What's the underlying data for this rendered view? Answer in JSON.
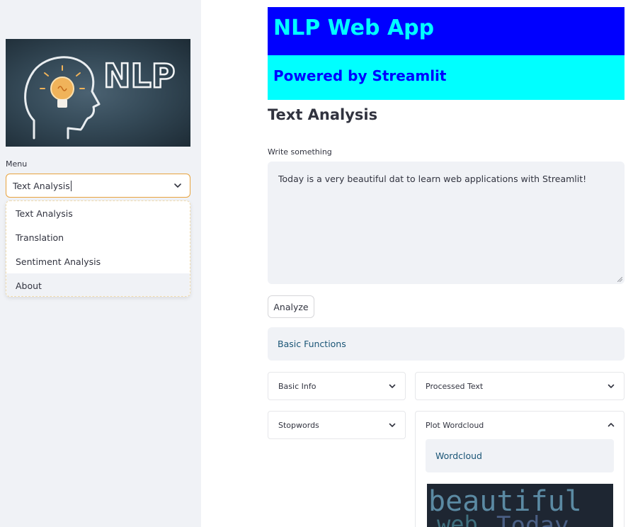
{
  "sidebar": {
    "image": {
      "label": "NLP"
    },
    "menu_label": "Menu",
    "select_value": "Text Analysis",
    "options": [
      "Text Analysis",
      "Translation",
      "Sentiment Analysis",
      "About"
    ],
    "hovered_option": "About"
  },
  "main": {
    "banner_title": "NLP Web App",
    "banner_subtitle": "Powered by Streamlit",
    "section_title": "Text Analysis",
    "textarea_label": "Write something",
    "textarea_value": "Today is a very beautiful dat to learn web applications with Streamlit!",
    "analyze_label": "Analyze",
    "info_label": "Basic Functions",
    "expanders": {
      "basic_info": "Basic Info",
      "processed_text": "Processed Text",
      "stopwords": "Stopwords",
      "plot_wordcloud": "Plot Wordcloud"
    },
    "wordcloud_label": "Wordcloud",
    "wordcloud_words": [
      "beautiful",
      "web",
      "Today"
    ]
  },
  "colors": {
    "banner_bg": "#0000ff",
    "banner_fg": "#00ffff",
    "sub_bg": "#00ffff",
    "sub_fg": "#0000ff",
    "accent": "#e8a33d",
    "sidebar_bg": "#f0f2f6"
  }
}
